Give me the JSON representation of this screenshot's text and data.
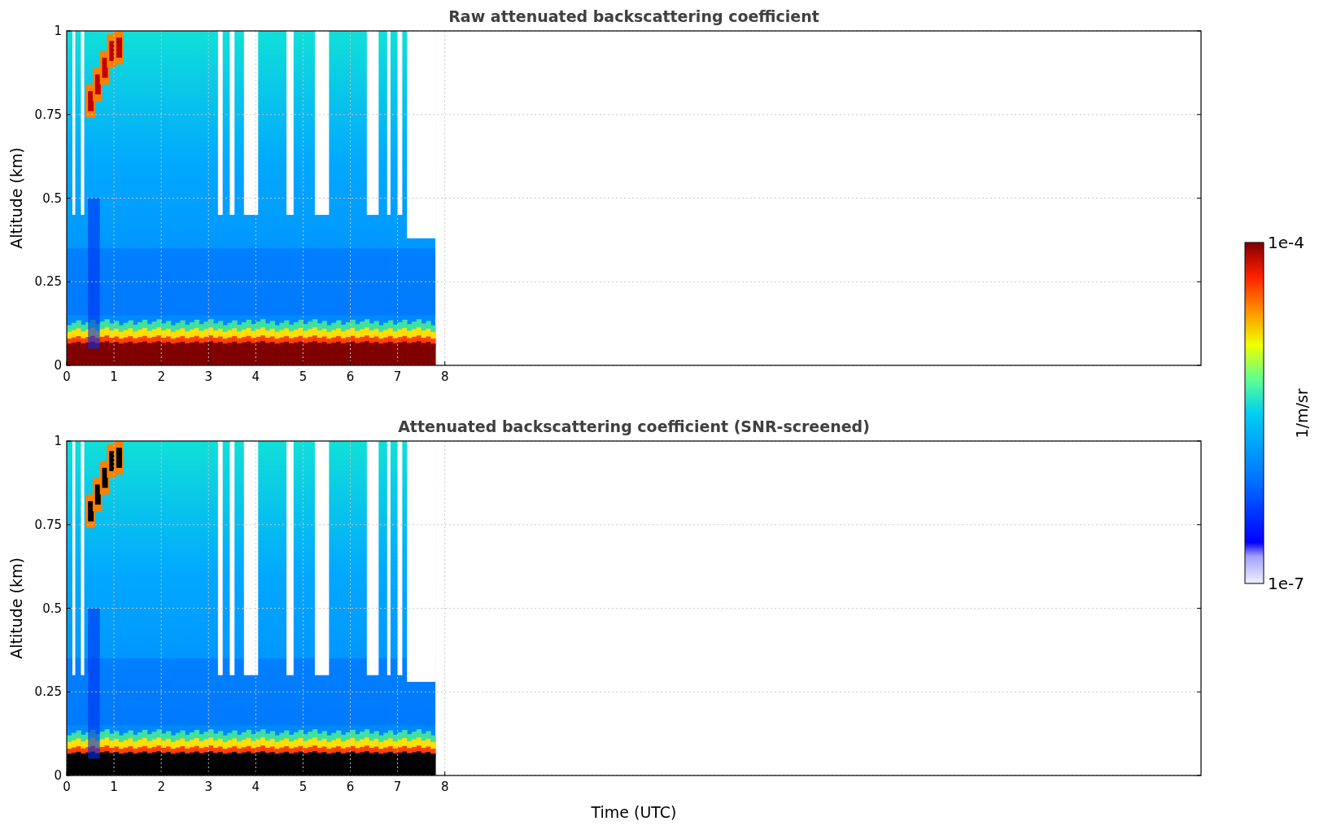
{
  "panels": [
    {
      "title": "Raw attenuated backscattering coefficient",
      "ylabel": "Altitude (km)",
      "yticks": [
        "1",
        "0.75",
        "0.5",
        "0.25",
        "0"
      ],
      "xticks": [
        "0",
        "1",
        "2",
        "3",
        "4",
        "5",
        "6",
        "7",
        "8"
      ],
      "kind": "raw"
    },
    {
      "title": "Attenuated backscattering coefficient (SNR-screened)",
      "ylabel": "Altitude (km)",
      "yticks": [
        "1",
        "0.75",
        "0.5",
        "0.25",
        "0"
      ],
      "xticks": [
        "0",
        "1",
        "2",
        "3",
        "4",
        "5",
        "6",
        "7",
        "8"
      ],
      "kind": "screened"
    }
  ],
  "xlabel": "Time (UTC)",
  "colorbar": {
    "max_label": "1e-4",
    "min_label": "1e-7",
    "unit": "1/m/sr"
  }
}
